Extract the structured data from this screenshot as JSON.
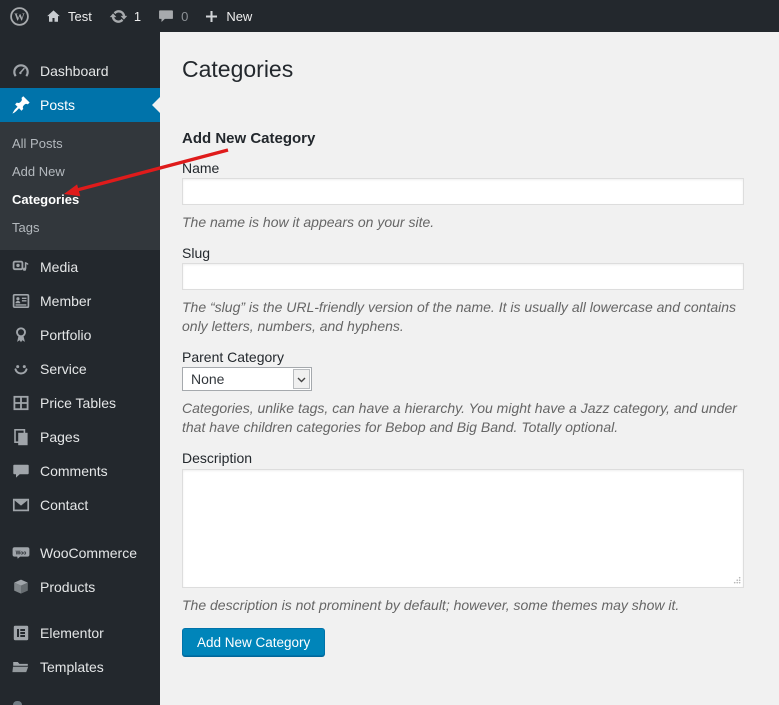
{
  "admin_bar": {
    "site_name": "Test",
    "updates_count": "1",
    "comments_count": "0",
    "new_label": "New"
  },
  "sidebar": {
    "items": [
      {
        "label": "Dashboard",
        "icon": "dashboard-icon",
        "active": false
      },
      {
        "label": "Posts",
        "icon": "pushpin-icon",
        "active": true
      },
      {
        "label": "Media",
        "icon": "media-icon",
        "active": false
      },
      {
        "label": "Member",
        "icon": "id-card-icon",
        "active": false
      },
      {
        "label": "Portfolio",
        "icon": "award-icon",
        "active": false
      },
      {
        "label": "Service",
        "icon": "smiley-icon",
        "active": false
      },
      {
        "label": "Price Tables",
        "icon": "grid-icon",
        "active": false
      },
      {
        "label": "Pages",
        "icon": "pages-icon",
        "active": false
      },
      {
        "label": "Comments",
        "icon": "comment-icon",
        "active": false
      },
      {
        "label": "Contact",
        "icon": "envelope-icon",
        "active": false
      },
      {
        "label": "WooCommerce",
        "icon": "woo-bubble-icon",
        "active": false
      },
      {
        "label": "Products",
        "icon": "box-icon",
        "active": false
      },
      {
        "label": "Elementor",
        "icon": "elementor-icon",
        "active": false
      },
      {
        "label": "Templates",
        "icon": "folder-icon",
        "active": false
      }
    ],
    "posts_submenu": [
      "All Posts",
      "Add New",
      "Categories",
      "Tags"
    ],
    "current_submenu_item": "Categories"
  },
  "main": {
    "page_title": "Categories",
    "form_title": "Add New Category",
    "fields": {
      "name": {
        "label": "Name",
        "value": "",
        "help": "The name is how it appears on your site."
      },
      "slug": {
        "label": "Slug",
        "value": "",
        "help": "The “slug” is the URL-friendly version of the name. It is usually all lowercase and contains only letters, numbers, and hyphens."
      },
      "parent": {
        "label": "Parent Category",
        "selected": "None",
        "help": "Categories, unlike tags, can have a hierarchy. You might have a Jazz category, and under that have children categories for Bebop and Big Band. Totally optional."
      },
      "description": {
        "label": "Description",
        "value": "",
        "help": "The description is not prominent by default; however, some themes may show it."
      }
    },
    "submit_label": "Add New Category"
  },
  "annotation": {
    "type": "arrow",
    "color": "#df1b1b",
    "points_to": "Categories sidebar item"
  },
  "colors": {
    "admin_bar_bg": "#23282d",
    "sidebar_bg": "#23282d",
    "submenu_bg": "#32373c",
    "active_blue": "#0073aa",
    "button_blue": "#0085ba",
    "content_bg": "#f1f1f1"
  }
}
